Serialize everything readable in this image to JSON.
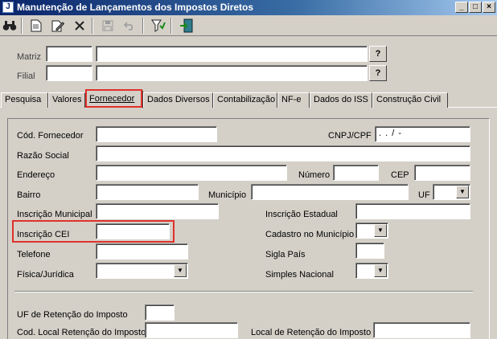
{
  "window": {
    "title": "Manutenção de Lançamentos dos Impostos Diretos",
    "app_icon": "J",
    "minimize_glyph": "_",
    "maximize_glyph": "□",
    "close_glyph": "×"
  },
  "toolbar": {
    "search": "binoculars-icon",
    "new": "new-document-icon",
    "edit": "edit-document-icon",
    "delete": "delete-x-icon",
    "save": "save-disk-icon",
    "undo": "undo-icon",
    "filter": "filter-icon",
    "exit": "exit-door-icon"
  },
  "header": {
    "matriz_label": "Matriz",
    "filial_label": "Filial",
    "lookup_glyph": "?"
  },
  "tabs": [
    {
      "label": "Pesquisa"
    },
    {
      "label": "Valores"
    },
    {
      "label": "Fornecedor"
    },
    {
      "label": "Dados Diversos"
    },
    {
      "label": "Contabilização"
    },
    {
      "label": "NF-e"
    },
    {
      "label": "Dados do ISS"
    },
    {
      "label": "Construção Civil"
    }
  ],
  "active_tab": "Fornecedor",
  "form": {
    "cod_fornecedor": "Cód. Fornecedor",
    "cnpj_cpf": "CNPJ/CPF",
    "cnpj_mask": ".  .  /  -",
    "razao_social": "Razão Social",
    "endereco": "Endereço",
    "numero": "Número",
    "cep": "CEP",
    "bairro": "Bairro",
    "municipio": "Município",
    "uf": "UF",
    "inscricao_municipal": "Inscrição Municipal",
    "inscricao_estadual": "Inscrição Estadual",
    "inscricao_cei": "Inscrição CEI",
    "cadastro_municipio": "Cadastro no Município",
    "telefone": "Telefone",
    "sigla_pais": "Sigla País",
    "fisica_juridica": "Física/Jurídica",
    "simples_nacional": "Simples Nacional",
    "uf_retencao": "UF de Retenção do Imposto",
    "cod_local_retencao": "Cod. Local Retenção do Imposto",
    "local_retencao": "Local de Retenção do Imposto",
    "dropdown_glyph": "▼"
  },
  "colors": {
    "title_start": "#0a246a",
    "title_end": "#a6caf0",
    "face": "#d4d0c8",
    "highlight": "#e0312b"
  }
}
